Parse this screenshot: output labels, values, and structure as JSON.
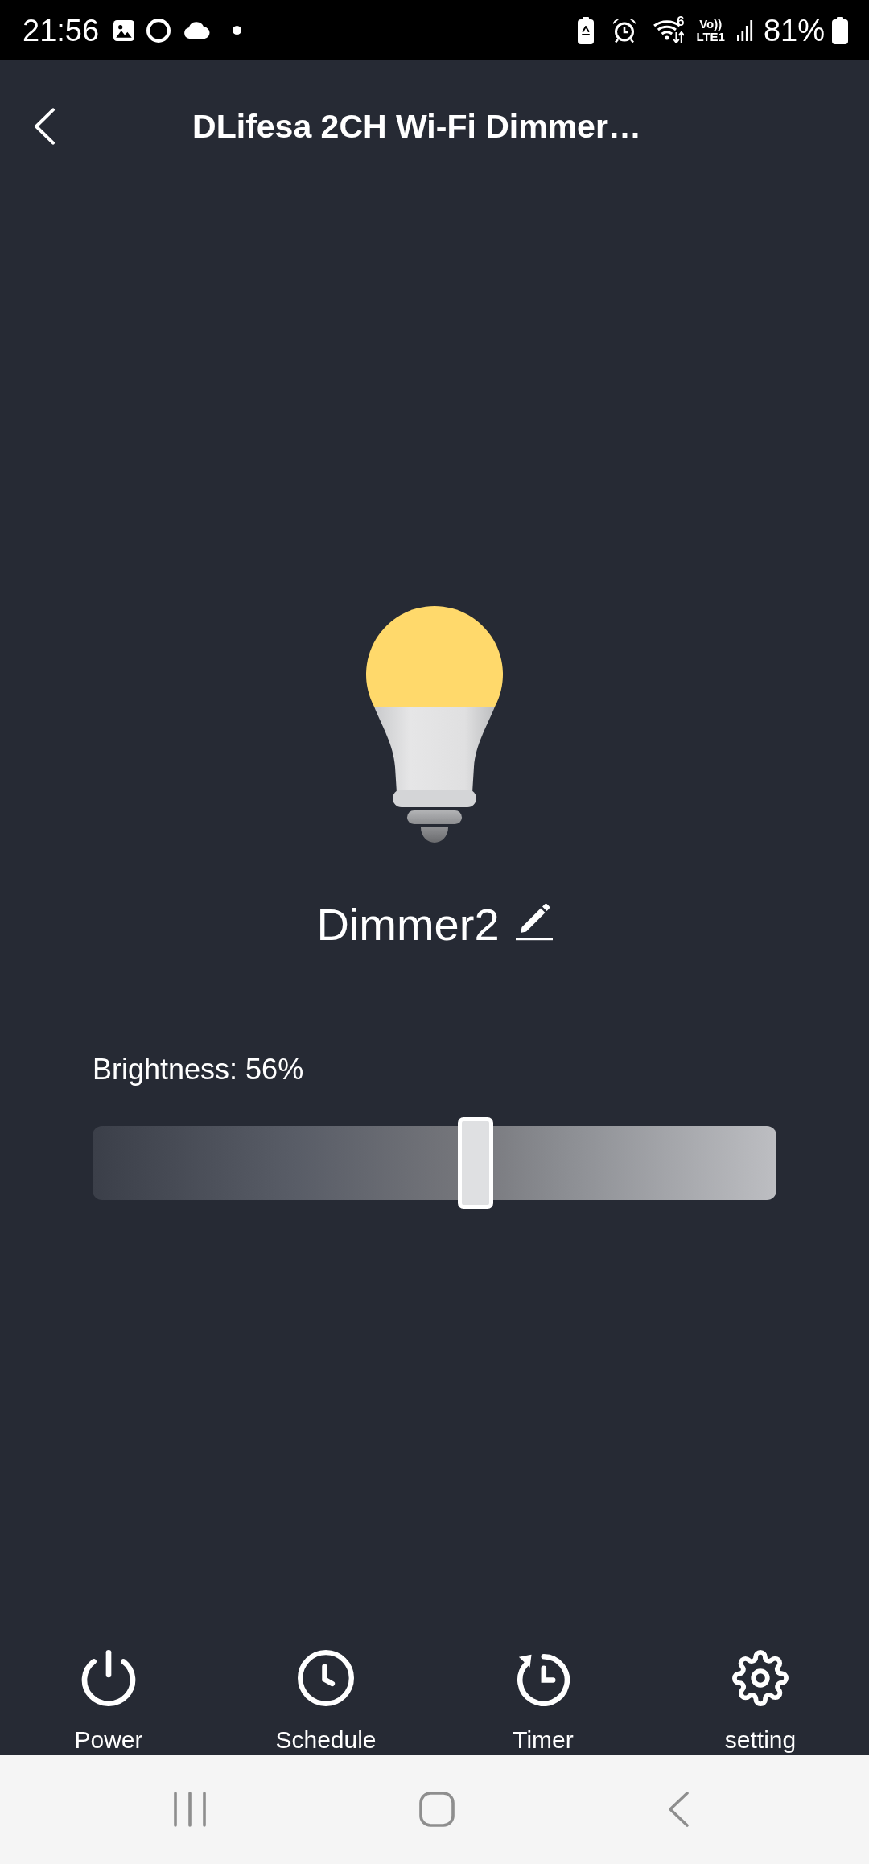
{
  "status_bar": {
    "time": "21:56",
    "wifi_label": "6",
    "network_label_top": "Vo))",
    "network_label_bottom": "LTE1",
    "battery": "81%"
  },
  "header": {
    "title": "DLifesa 2CH Wi-Fi Dimmer…"
  },
  "device": {
    "name": "Dimmer2",
    "on": true
  },
  "brightness": {
    "label": "Brightness: 56%",
    "level": 0.56
  },
  "actions": [
    {
      "kind": "power",
      "label": "Power"
    },
    {
      "kind": "schedule",
      "label": "Schedule"
    },
    {
      "kind": "timer",
      "label": "Timer"
    },
    {
      "kind": "settings",
      "label": "setting"
    }
  ]
}
